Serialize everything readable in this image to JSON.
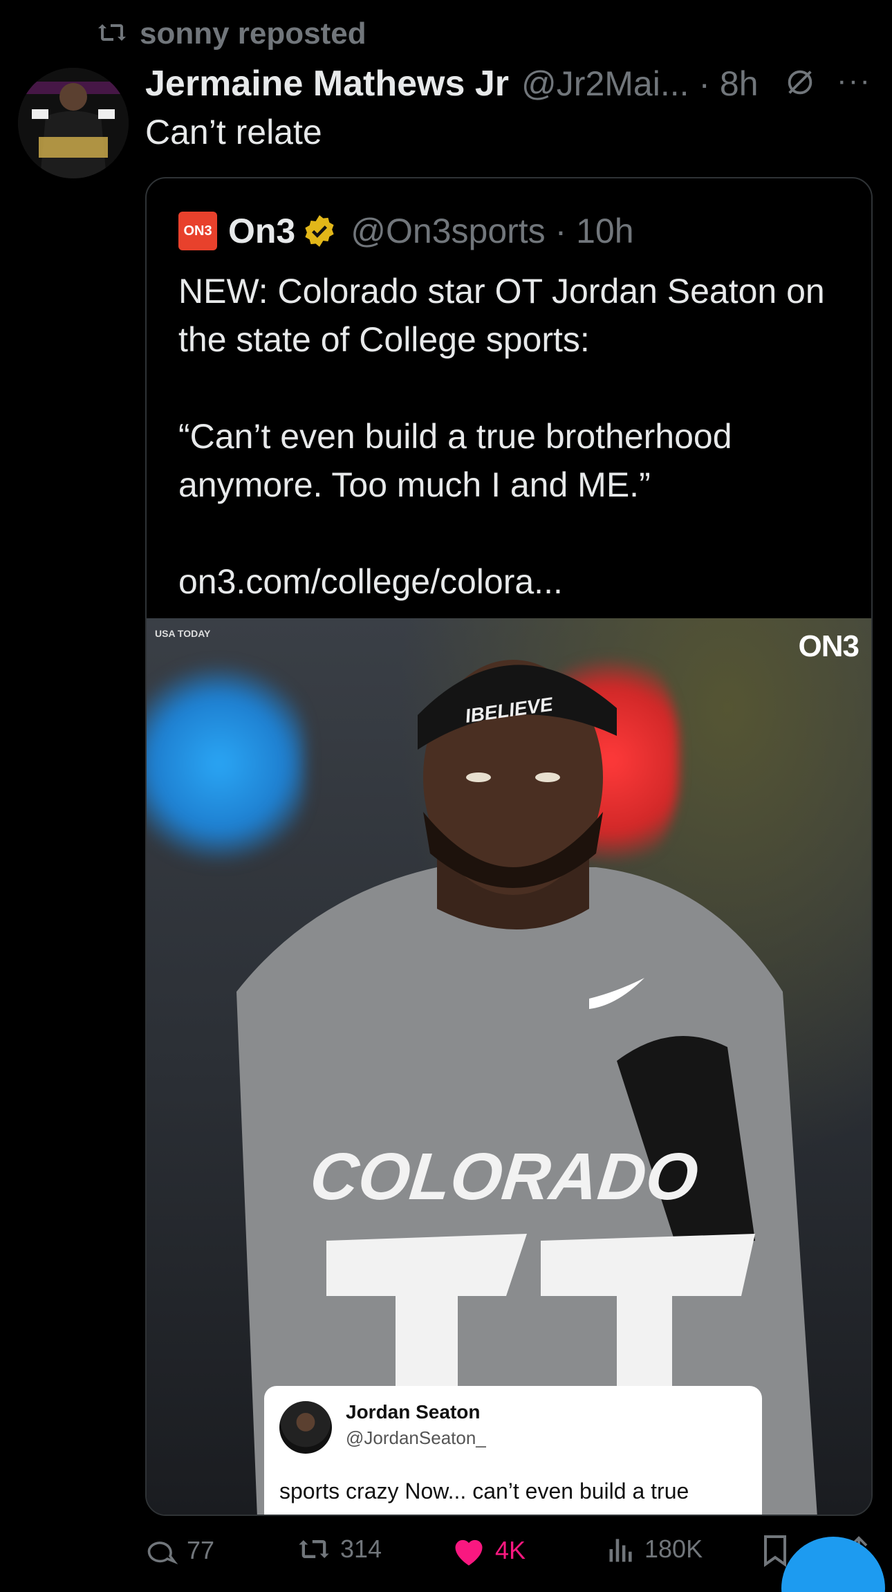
{
  "repost": {
    "text": "sonny reposted",
    "icon": "repost-icon"
  },
  "post": {
    "author_name": "Jermaine Mathews Jr",
    "author_handle_time": "@Jr2Mai... · 8h",
    "text": "Can’t relate"
  },
  "quote": {
    "name": "On3",
    "badge_text": "ON3",
    "handle_time": "@On3sports · 10h",
    "para1": "NEW: Colorado star OT Jordan Seaton on the state of College sports:",
    "para2": "“Can’t even build a true brotherhood anymore. Too much I and ME.”",
    "link": "on3.com/college/colora...",
    "photo_credit": "USA TODAY",
    "photo_logo": "ON3",
    "embedded_tweet": {
      "name": "Jordan Seaton",
      "handle": "@JordanSeaton_",
      "text": "sports crazy Now... can’t even build a true\nbrotherhood anymore too much\n I and ME"
    }
  },
  "actions": {
    "replies": "77",
    "reposts": "314",
    "likes": "4K",
    "views": "180K"
  },
  "colors": {
    "like": "#f91880",
    "accent": "#1d9bf0",
    "muted": "#71767b"
  }
}
